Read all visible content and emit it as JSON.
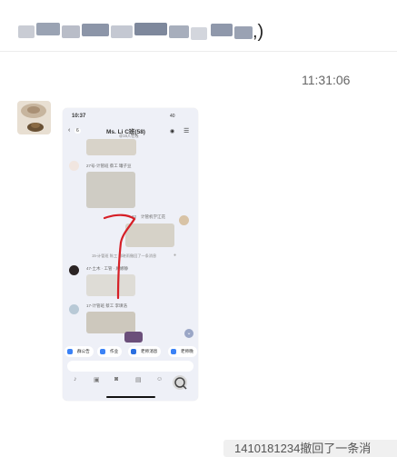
{
  "header": {
    "title_visible_tail": ",)"
  },
  "message_time": "11:31:06",
  "phone": {
    "status_time": "10:37",
    "status_battery": "40",
    "back_count": "6",
    "chat_title": "Ms. Li C班(58)",
    "chat_subtitle": "@16人在线",
    "msg1_sender": "27号-计管班 蔡工 罐子豆",
    "msg2_sender": "计管机学江花",
    "msg2_number": "32",
    "recall_notice": "15-计管班 陈工 邹晓雨撤回了一条消息",
    "msg3_sender": "47-土木 · 工管 · 顾娜静",
    "msg4_sender": "17-计管班 蔡工 李璜浩",
    "chips": [
      "群公告",
      "作业",
      "老师消息",
      "老师晚"
    ],
    "chip_colors": [
      "#3b82f6",
      "#3b82f6",
      "#2b6fe0",
      "#3b82f6"
    ]
  },
  "recall_bar": "1410181234撤回了一条消"
}
